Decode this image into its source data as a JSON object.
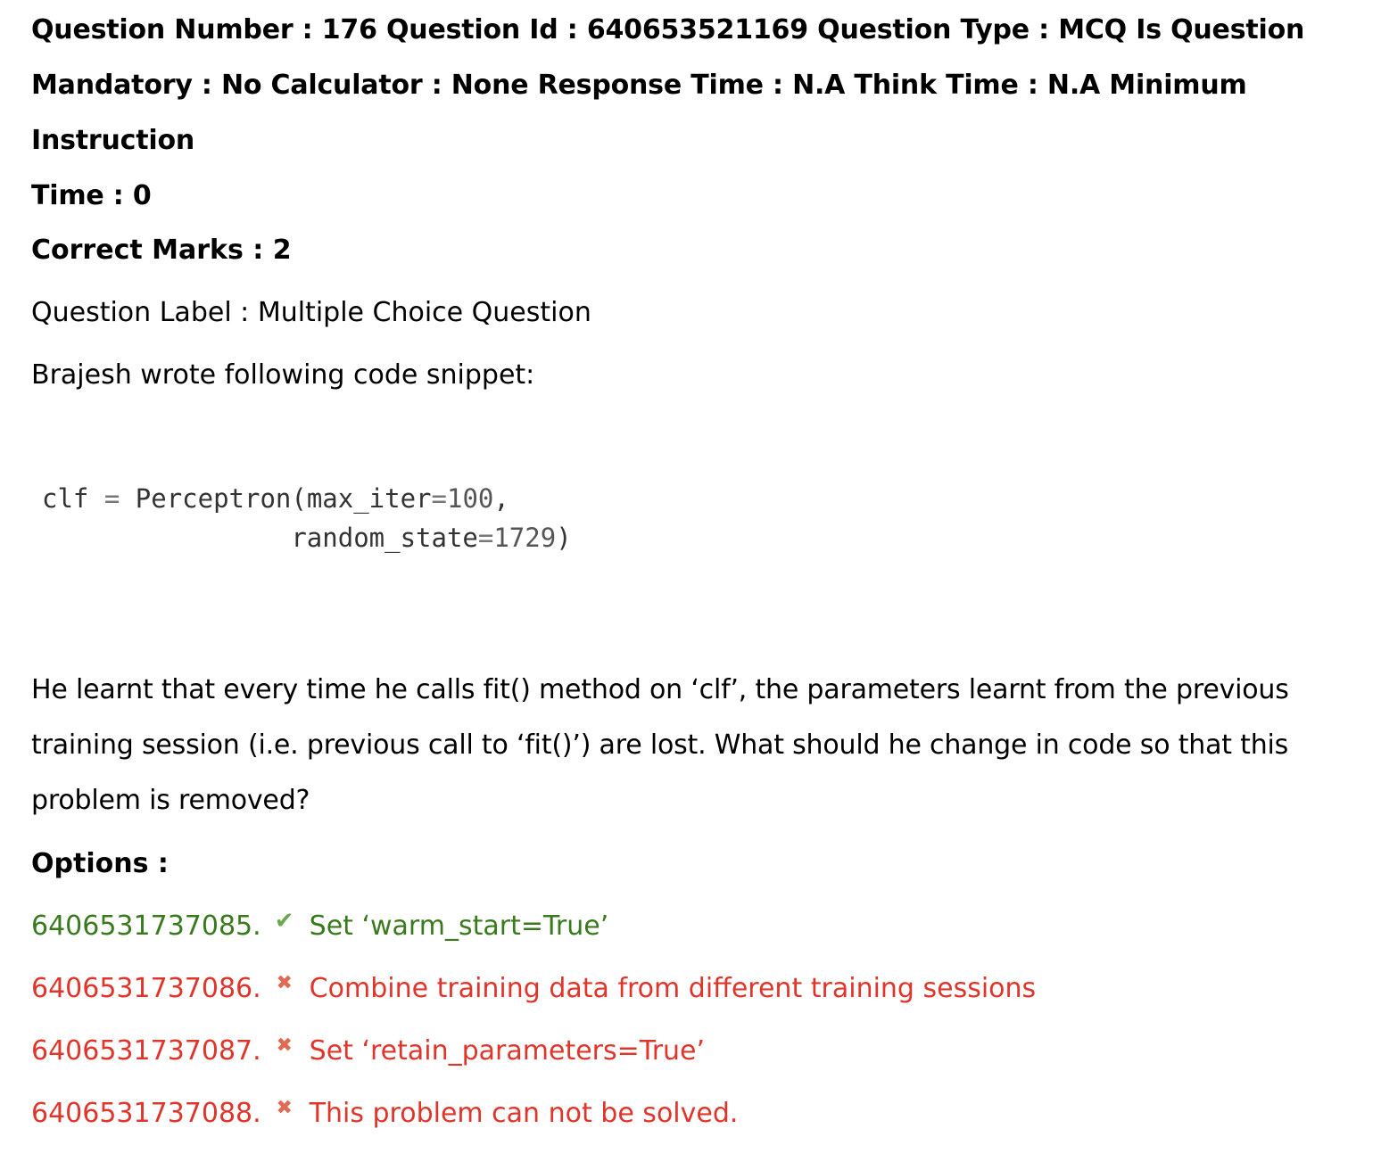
{
  "meta": {
    "line1": "Question Number : 176 Question Id : 640653521169 Question Type : MCQ Is Question",
    "line2": "Mandatory : No Calculator : None Response Time : N.A Think Time : N.A Minimum Instruction",
    "line3": "Time : 0"
  },
  "correct_marks": "Correct Marks : 2",
  "question_label": "Question Label : Multiple Choice Question",
  "intro": "Brajesh wrote following code snippet:",
  "code": {
    "line1_a": "clf ",
    "line1_op": "=",
    "line1_b": " Perceptron(max_iter",
    "line1_op2": "=",
    "line1_num": "100",
    "line1_c": ",",
    "line2_a": "                random_state",
    "line2_op": "=",
    "line2_num": "1729",
    "line2_c": ")"
  },
  "question": {
    "line1": "He learnt that every time he calls fit() method on ‘clf’, the parameters learnt from the previous",
    "line2": "training session (i.e. previous call to ‘fit()’) are lost. What should he change in code so that this",
    "line3": "problem is removed?"
  },
  "options_title": "Options :",
  "options": [
    {
      "id": "6406531737085.",
      "text": "Set ‘warm_start=True’",
      "correct": true,
      "icon": "check-icon"
    },
    {
      "id": "6406531737086.",
      "text": "Combine training data from different training sessions",
      "correct": false,
      "icon": "cross-icon"
    },
    {
      "id": "6406531737087.",
      "text": "Set ‘retain_parameters=True’",
      "correct": false,
      "icon": "cross-icon"
    },
    {
      "id": "6406531737088.",
      "text": "This problem can not be solved.",
      "correct": false,
      "icon": "cross-icon"
    }
  ],
  "colors": {
    "correct": "#3a7a1e",
    "wrong": "#e0352b"
  }
}
